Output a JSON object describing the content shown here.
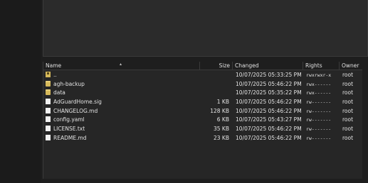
{
  "columns": {
    "name": "Name",
    "size": "Size",
    "changed": "Changed",
    "rights": "Rights",
    "owner": "Owner"
  },
  "files": [
    {
      "name": "..",
      "size": "",
      "changed": "10/07/2025 05:33:25 PM",
      "rights": "rwxrwxr-x",
      "owner": "root",
      "icon": "parent-dir-icon"
    },
    {
      "name": "agh-backup",
      "size": "",
      "changed": "10/07/2025 05:46:22 PM",
      "rights": "rwx------",
      "owner": "root",
      "icon": "folder-icon"
    },
    {
      "name": "data",
      "size": "",
      "changed": "10/07/2025 05:35:22 PM",
      "rights": "rwx------",
      "owner": "root",
      "icon": "folder-icon"
    },
    {
      "name": "AdGuardHome.sig",
      "size": "1 KB",
      "changed": "10/07/2025 05:46:22 PM",
      "rights": "rw-------",
      "owner": "root",
      "icon": "file-icon"
    },
    {
      "name": "CHANGELOG.md",
      "size": "128 KB",
      "changed": "10/07/2025 05:46:22 PM",
      "rights": "rw-------",
      "owner": "root",
      "icon": "file-icon"
    },
    {
      "name": "config.yaml",
      "size": "6 KB",
      "changed": "10/07/2025 05:43:27 PM",
      "rights": "rw-------",
      "owner": "root",
      "icon": "file-icon"
    },
    {
      "name": "LICENSE.txt",
      "size": "35 KB",
      "changed": "10/07/2025 05:46:22 PM",
      "rights": "rw-------",
      "owner": "root",
      "icon": "file-icon"
    },
    {
      "name": "README.md",
      "size": "23 KB",
      "changed": "10/07/2025 05:46:22 PM",
      "rights": "rw-------",
      "owner": "root",
      "icon": "file-icon"
    }
  ],
  "sort": {
    "column": "Name",
    "direction": "ascending"
  },
  "colors": {
    "background": "#1e1e1e",
    "pane": "#262626",
    "folder": "#d6b95a"
  }
}
